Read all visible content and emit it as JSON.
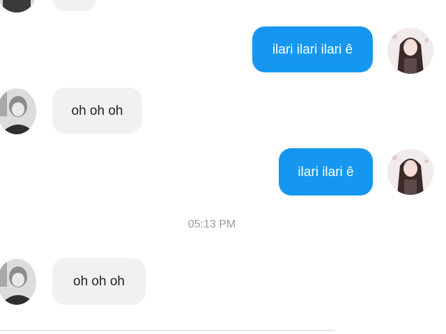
{
  "conversation": {
    "messages": [
      {
        "direction": "sent",
        "text": "ilari ilari ilari ê"
      },
      {
        "direction": "received",
        "text": "oh oh oh"
      },
      {
        "direction": "sent",
        "text": "ilari ilari ê"
      },
      {
        "direction": "received",
        "text": "oh oh oh"
      }
    ],
    "timestamp": "05:13 PM"
  },
  "colors": {
    "sent_bubble": "#1597f0",
    "received_bubble": "#f1f1f3",
    "timestamp_text": "#9a9a9a"
  }
}
